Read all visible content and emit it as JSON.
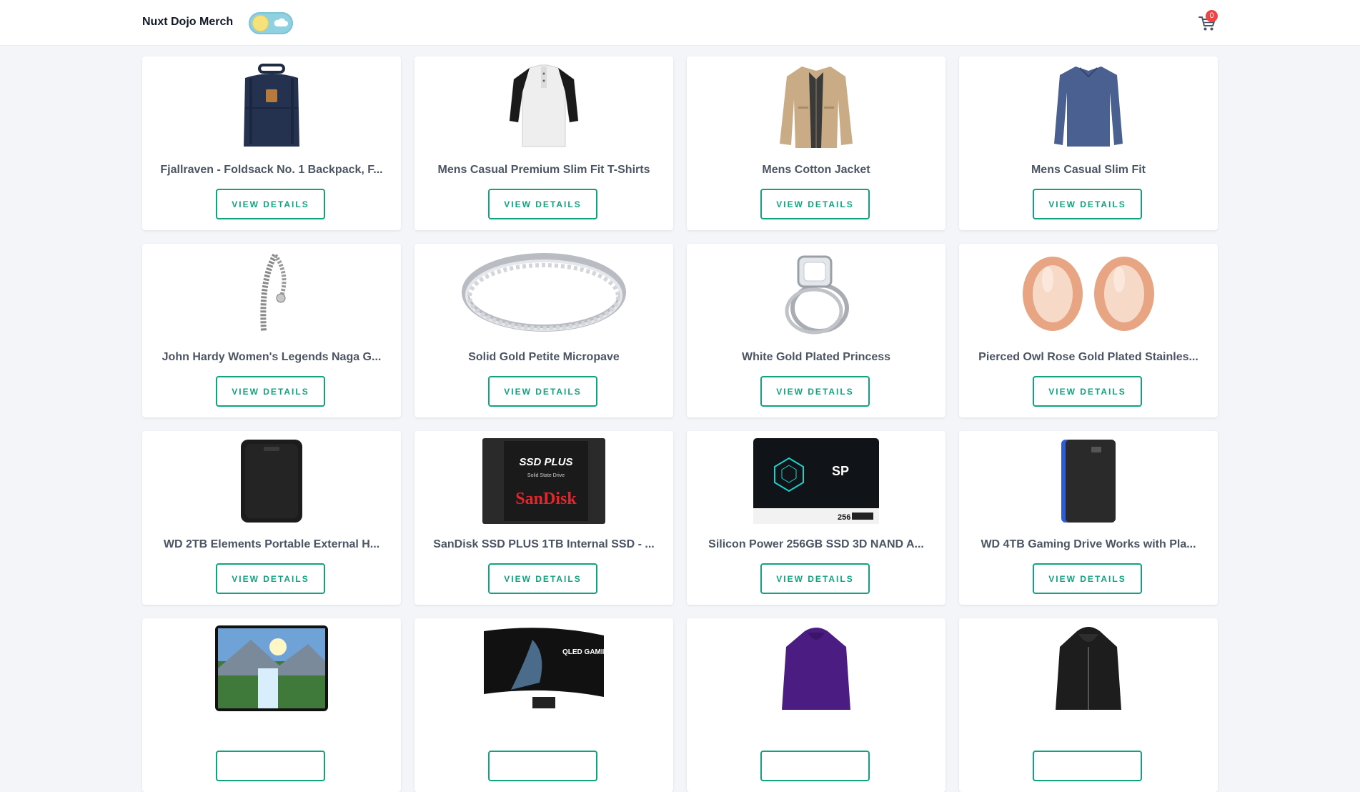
{
  "header": {
    "brand": "Nuxt Dojo Merch",
    "cart_count": "0"
  },
  "colors": {
    "accent": "#10a37f",
    "badge": "#ef4444",
    "toggle": "#8fd0e1",
    "sun": "#f6e27a"
  },
  "icons": {
    "theme_toggle": "sun-cloud-toggle-icon",
    "cart": "shopping-cart-icon"
  },
  "products": [
    {
      "title": "Fjallraven - Foldsack No. 1 Backpack, F...",
      "button": "VIEW DETAILS",
      "image": "backpack"
    },
    {
      "title": "Mens Casual Premium Slim Fit T-Shirts",
      "button": "VIEW DETAILS",
      "image": "tshirt"
    },
    {
      "title": "Mens Cotton Jacket",
      "button": "VIEW DETAILS",
      "image": "jacket"
    },
    {
      "title": "Mens Casual Slim Fit",
      "button": "VIEW DETAILS",
      "image": "longsleeve"
    },
    {
      "title": "John Hardy Women's Legends Naga G...",
      "button": "VIEW DETAILS",
      "image": "bracelet"
    },
    {
      "title": "Solid Gold Petite Micropave",
      "button": "VIEW DETAILS",
      "image": "ring"
    },
    {
      "title": "White Gold Plated Princess",
      "button": "VIEW DETAILS",
      "image": "diamond-ring"
    },
    {
      "title": "Pierced Owl Rose Gold Plated Stainles...",
      "button": "VIEW DETAILS",
      "image": "plugs"
    },
    {
      "title": "WD 2TB Elements Portable External H...",
      "button": "VIEW DETAILS",
      "image": "hdd-black"
    },
    {
      "title": "SanDisk SSD PLUS 1TB Internal SSD - ...",
      "button": "VIEW DETAILS",
      "image": "ssd-sandisk",
      "image_text": [
        "SSD PLUS",
        "Solid State Drive",
        "SanDisk"
      ]
    },
    {
      "title": "Silicon Power 256GB SSD 3D NAND A...",
      "button": "VIEW DETAILS",
      "image": "ssd-sp",
      "image_text": [
        "SP",
        "256"
      ]
    },
    {
      "title": "WD 4TB Gaming Drive Works with Pla...",
      "button": "VIEW DETAILS",
      "image": "hdd-gaming"
    },
    {
      "title": "",
      "button": "",
      "image": "monitor-landscape"
    },
    {
      "title": "",
      "button": "",
      "image": "curved-monitor",
      "image_text": [
        "QLED GAMING MONITOR"
      ]
    },
    {
      "title": "",
      "button": "",
      "image": "purple-jacket"
    },
    {
      "title": "",
      "button": "",
      "image": "black-leather-jacket"
    }
  ]
}
